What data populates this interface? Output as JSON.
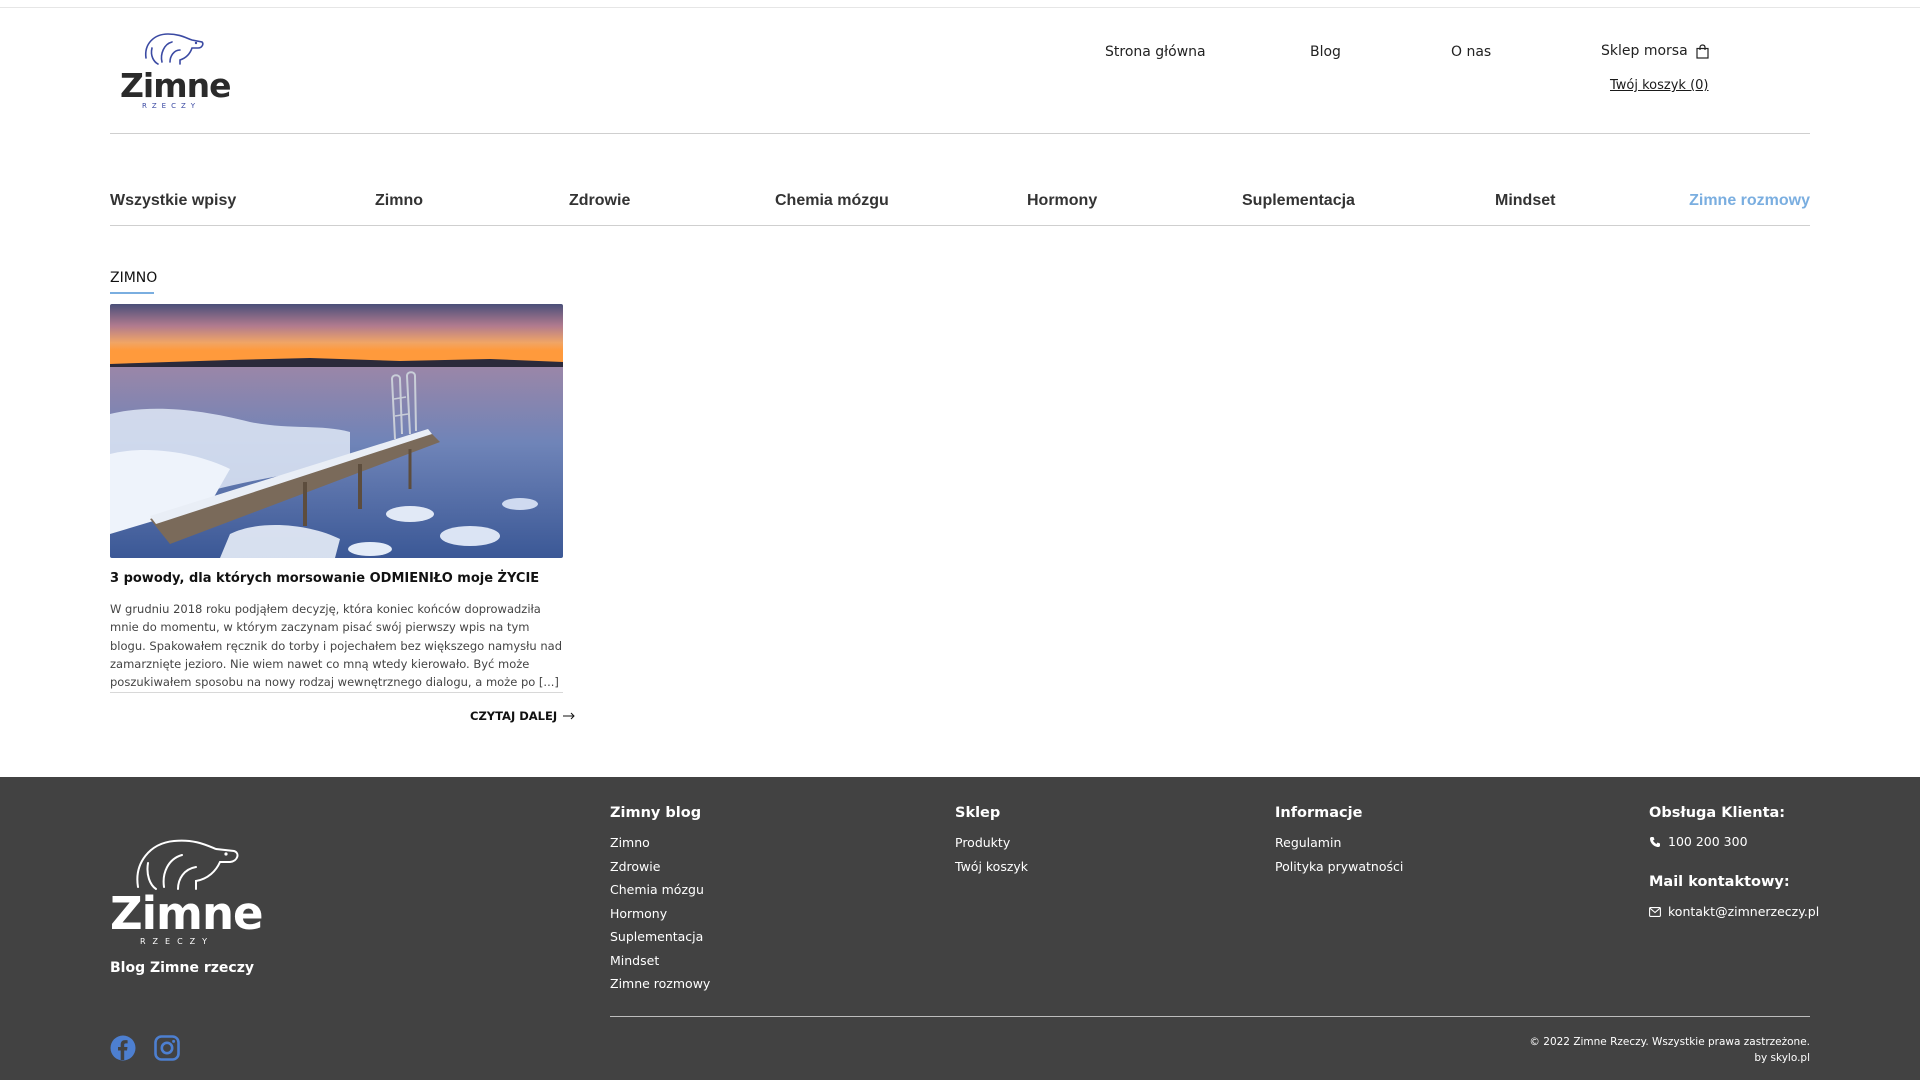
{
  "brand": {
    "logo_word": "Zimne",
    "logo_sub": "RZECZY"
  },
  "nav": {
    "home": "Strona główna",
    "blog": "Blog",
    "about": "O nas",
    "shop": "Sklep morsa",
    "cart": "Twój koszyk (0)"
  },
  "categories": [
    {
      "label": "Wszystkie wpisy",
      "active": false
    },
    {
      "label": "Zimno",
      "active": false
    },
    {
      "label": "Zdrowie",
      "active": false
    },
    {
      "label": "Chemia mózgu",
      "active": false
    },
    {
      "label": "Hormony",
      "active": false
    },
    {
      "label": "Suplementacja",
      "active": false
    },
    {
      "label": "Mindset",
      "active": false
    },
    {
      "label": "Zimne rozmowy",
      "active": true
    }
  ],
  "section": {
    "label": "ZIMNO"
  },
  "post": {
    "title": "3 powody, dla których morsowanie ODMIENIŁO moje ŻYCIE",
    "excerpt": "W grudniu 2018 roku podjąłem decyzję, która koniec końców doprowadziła mnie do momentu, w którym zaczynam pisać swój pierwszy wpis na tym blogu. Spakowałem ręcznik do torby i pojechałem bez większego namysłu nad zamarznięte jezioro. Nie wiem nawet co mną wtedy kierowało. Być może poszukiwałem sposobu na nowy rodzaj wewnętrznego dialogu, a może po [...]",
    "read_more": "CZYTAJ DALEJ"
  },
  "footer": {
    "blog_name": "Blog Zimne rzeczy",
    "col_blog": {
      "title": "Zimny blog",
      "items": [
        "Zimno",
        "Zdrowie",
        "Chemia mózgu",
        "Hormony",
        "Suplementacja",
        "Mindset",
        "Zimne rozmowy"
      ]
    },
    "col_shop": {
      "title": "Sklep",
      "items": [
        "Produkty",
        "Twój koszyk"
      ]
    },
    "col_info": {
      "title": "Informacje",
      "items": [
        "Regulamin",
        "Polityka prywatności"
      ]
    },
    "support": {
      "title": "Obsługa Klienta:",
      "phone": "100 200 300",
      "mail_title": "Mail kontaktowy:",
      "email": "kontakt@zimnerzeczy.pl"
    },
    "copyright": "© 2022 Zimne Rzeczy. Wszystkie prawa zastrzeżone.",
    "credit": "by skylo.pl"
  },
  "colors": {
    "accent": "#7aaee0",
    "footer_bg": "#424242",
    "brand_blue": "#3b4aa3"
  },
  "icons": [
    "bag-icon",
    "arrow-right-icon",
    "phone-icon",
    "mail-icon",
    "facebook-icon",
    "instagram-icon",
    "polar-bear-logo"
  ]
}
